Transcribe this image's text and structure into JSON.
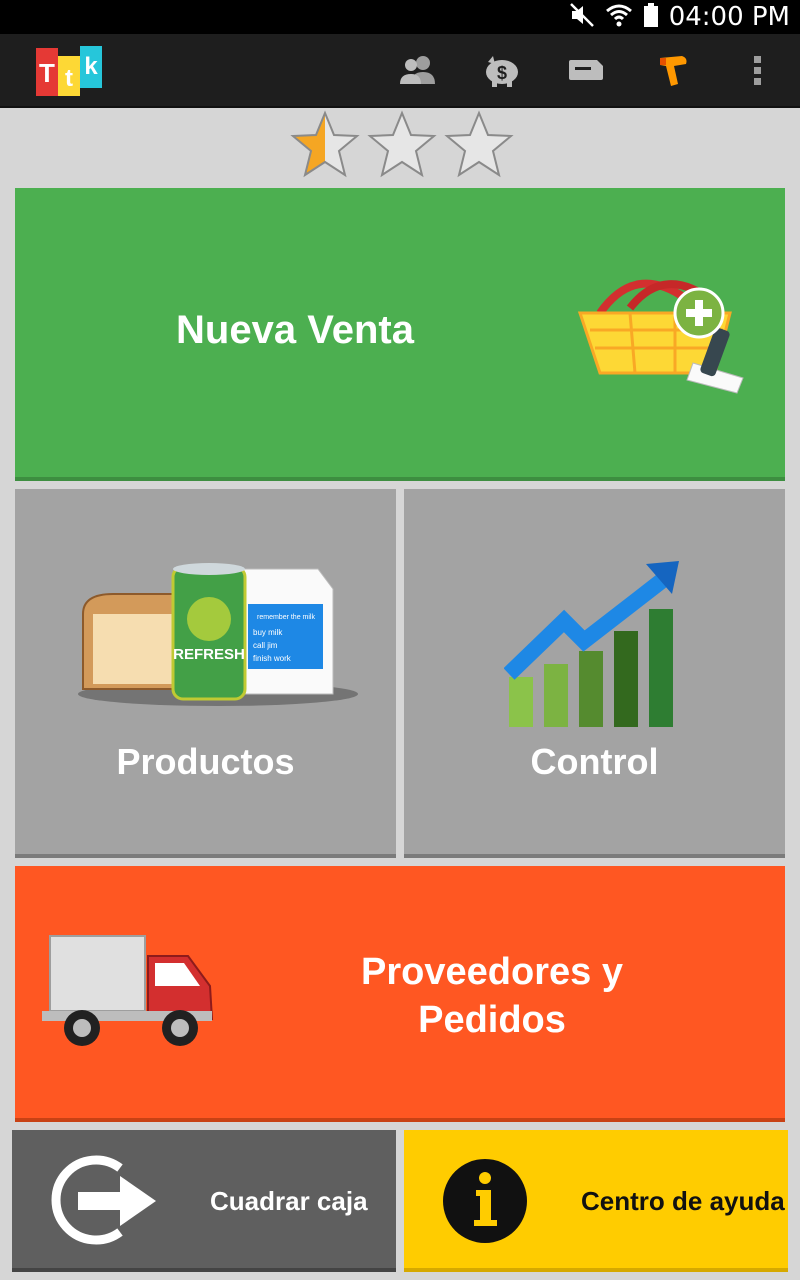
{
  "status_bar": {
    "time": "04:00 PM",
    "icons": [
      "mute-icon",
      "wifi-icon",
      "battery-icon"
    ]
  },
  "action_bar": {
    "logo_letters": [
      "T",
      "t",
      "k"
    ],
    "logo_colors": [
      "#e53935",
      "#fdd835",
      "#26c6da"
    ],
    "actions": [
      "clients-icon",
      "piggy-bank-icon",
      "ticket-icon",
      "barcode-scanner-icon",
      "overflow-menu-icon"
    ]
  },
  "rating": {
    "filled": 0.5,
    "total": 3
  },
  "tiles": {
    "nueva_venta": {
      "label": "Nueva Venta",
      "color": "#4caf50"
    },
    "productos": {
      "label": "Productos",
      "color": "#a3a3a3",
      "can_text": "REFRESH",
      "carton_lines": [
        "buy milk",
        "call jim",
        "finish work"
      ],
      "carton_brand": "remember the milk"
    },
    "control": {
      "label": "Control",
      "color": "#a3a3a3"
    },
    "proveedores": {
      "label_line1": "Proveedores y",
      "label_line2": "Pedidos",
      "color": "#ff5722"
    },
    "cuadrar_caja": {
      "label": "Cuadrar caja",
      "color": "#5f5f5f"
    },
    "centro_ayuda": {
      "label": "Centro de ayuda",
      "color": "#ffcc00"
    }
  }
}
